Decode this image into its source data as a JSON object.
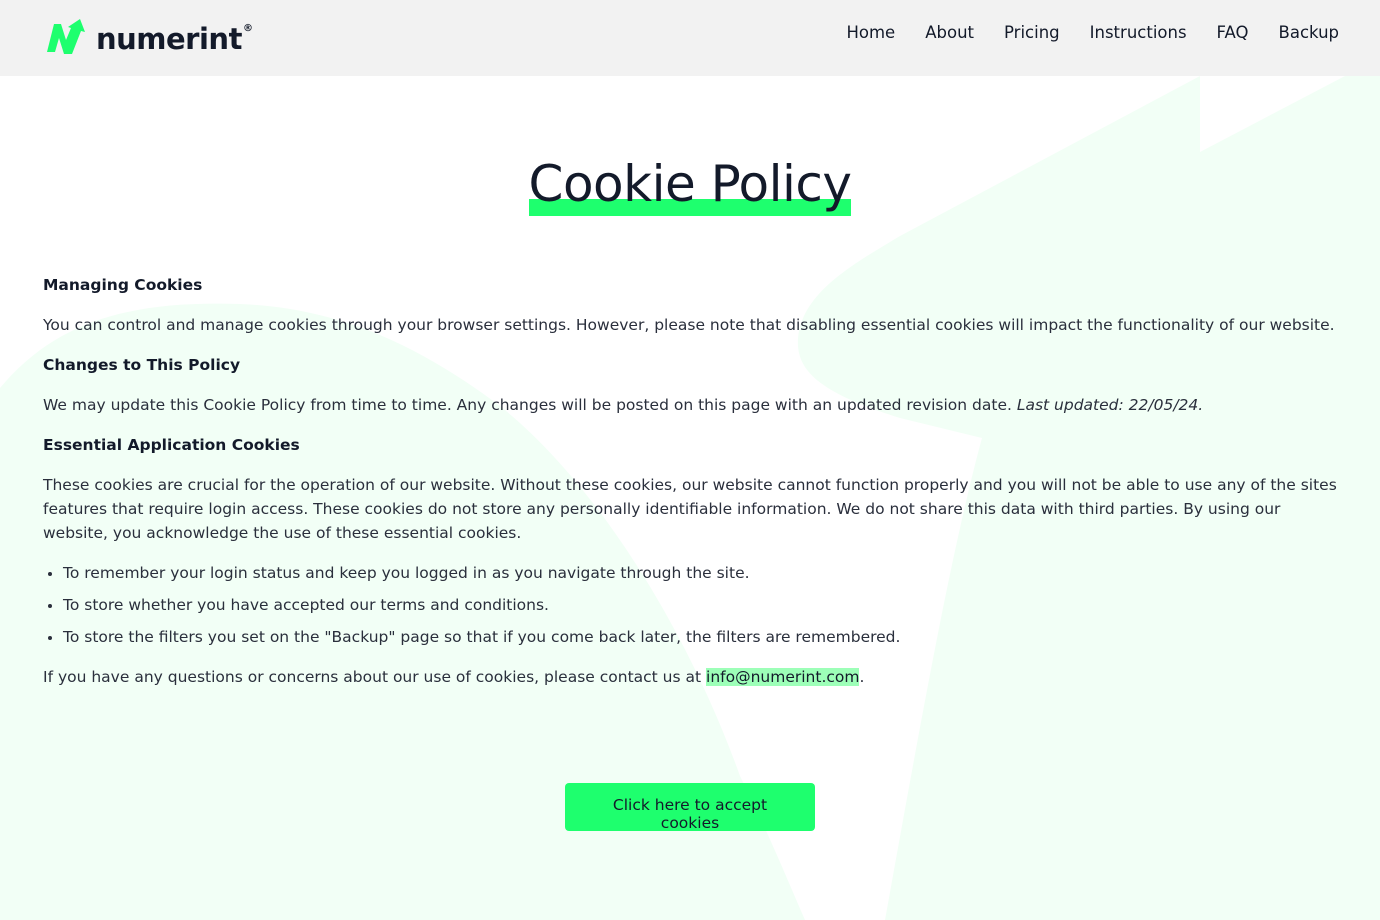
{
  "brand": {
    "name": "numerint",
    "registered_mark": "®",
    "logo_icon": "n-arrow-logo-icon",
    "accent_color": "#1eff6e",
    "email_highlight_color": "#9dffb8",
    "background_shape_color": "#f2fff6"
  },
  "nav": {
    "items": [
      {
        "label": "Home"
      },
      {
        "label": "About"
      },
      {
        "label": "Pricing"
      },
      {
        "label": "Instructions"
      },
      {
        "label": "FAQ"
      },
      {
        "label": "Backup"
      }
    ]
  },
  "page": {
    "title": "Cookie Policy",
    "sections": {
      "managing": {
        "heading": "Managing Cookies",
        "body": "You can control and manage cookies through your browser settings. However, please note that disabling essential cookies will impact the functionality of our website."
      },
      "changes": {
        "heading": "Changes to This Policy",
        "body": "We may update this Cookie Policy from time to time. Any changes will be posted on this page with an updated revision date. ",
        "last_updated": "Last updated: 22/05/24."
      },
      "essential": {
        "heading": "Essential Application Cookies",
        "body": "These cookies are crucial for the operation of our website. Without these cookies, our website cannot function properly and you will not be able to use any of the sites features that require login access. These cookies do not store any personally identifiable information. We do not share this data with third parties. By using our website, you acknowledge the use of these essential cookies.",
        "bullets": [
          "To remember your login status and keep you logged in as you navigate through the site.",
          "To store whether you have accepted our terms and conditions.",
          "To store the filters you set on the \"Backup\" page so that if you come back later, the filters are remembered."
        ]
      },
      "contact": {
        "prefix": "If you have any questions or concerns about our use of cookies, please contact us at ",
        "email": "info@numerint.com",
        "suffix": "."
      }
    },
    "accept_button": "Click here to accept cookies"
  }
}
